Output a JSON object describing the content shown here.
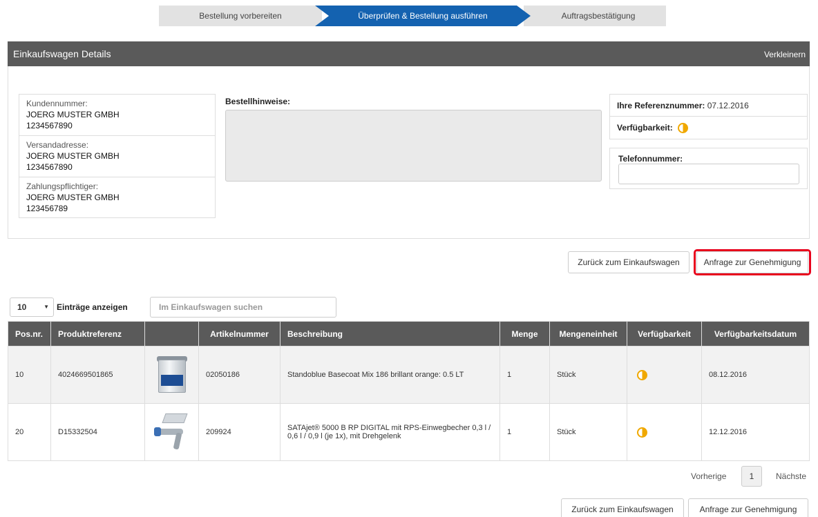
{
  "steps": [
    "Bestellung vorbereiten",
    "Überprüfen & Bestellung ausführen",
    "Auftragsbestätigung"
  ],
  "panel": {
    "title": "Einkaufswagen Details",
    "toggle": "Verkleinern"
  },
  "addresses": [
    {
      "label": "Kundennummer:",
      "name": "JOERG MUSTER GMBH",
      "number": "1234567890"
    },
    {
      "label": "Versandadresse:",
      "name": "JOERG MUSTER GMBH",
      "number": "1234567890"
    },
    {
      "label": "Zahlungspflichtiger:",
      "name": "JOERG MUSTER GMBH",
      "number": "123456789"
    }
  ],
  "notes": {
    "label": "Bestellhinweise:",
    "value": ""
  },
  "reference": {
    "label": "Ihre Referenznummer:",
    "value": "07.12.2016"
  },
  "availability": {
    "label": "Verfügbarkeit:",
    "icon": "half-availability-icon",
    "color": "#f0a800"
  },
  "phone": {
    "label": "Telefonnummer:",
    "value": ""
  },
  "buttons": {
    "back": "Zurück zum Einkaufswagen",
    "request": "Anfrage zur Genehmigung"
  },
  "table_controls": {
    "page_length": "10",
    "page_length_label": "Einträge anzeigen",
    "search_placeholder": "Im Einkaufswagen suchen"
  },
  "table": {
    "headers": [
      "Pos.nr.",
      "Produktreferenz",
      "",
      "Artikelnummer",
      "Beschreibung",
      "Menge",
      "Mengeneinheit",
      "Verfügbarkeit",
      "Verfügbarkeitsdatum"
    ],
    "rows": [
      {
        "pos": "10",
        "ref": "4024669501865",
        "image": "paint-can",
        "article": "02050186",
        "description": "Standoblue Basecoat Mix 186 brillant orange: 0.5 LT",
        "qty": "1",
        "unit": "Stück",
        "availability_icon": "half-availability-icon",
        "date": "08.12.2016"
      },
      {
        "pos": "20",
        "ref": "D15332504",
        "image": "spray-gun",
        "article": "209924",
        "description": "SATAjet® 5000 B RP DIGITAL mit RPS-Einwegbecher 0,3 l / 0,6 l / 0,9 l (je 1x), mit Drehgelenk",
        "qty": "1",
        "unit": "Stück",
        "availability_icon": "half-availability-icon",
        "date": "12.12.2016"
      }
    ]
  },
  "pager": {
    "previous": "Vorherige",
    "current": "1",
    "next": "Nächste"
  },
  "colors": {
    "accent": "#1462b0",
    "header": "#5a5a5a",
    "highlight": "#e8001c"
  }
}
